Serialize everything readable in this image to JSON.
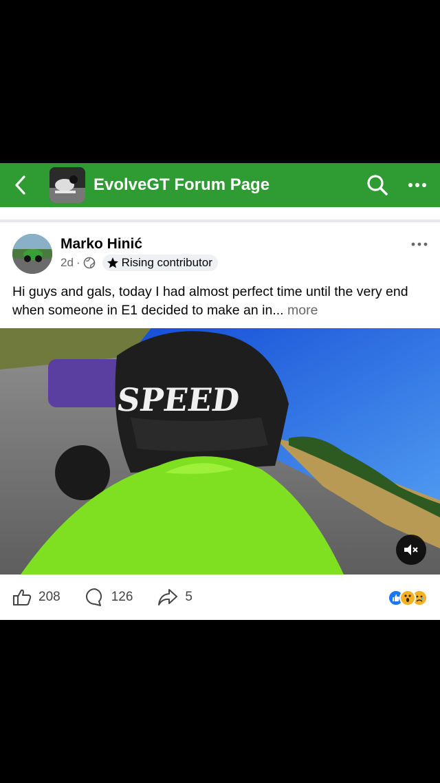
{
  "header": {
    "title": "EvolveGT Forum Page",
    "back_icon": "chevron-left-icon",
    "search_icon": "search-icon",
    "more_icon": "more-horizontal-icon",
    "bar_color": "#2f9b33"
  },
  "post": {
    "author": "Marko Hinić",
    "time": "2d",
    "separator": "·",
    "privacy_icon": "globe-icon",
    "badge_label": "Rising contributor",
    "badge_icon": "star-icon",
    "text": "Hi guys and gals, today I had almost perfect time until the very end when someone in E1 decided to make an in...",
    "more_label": "more",
    "media_icon": "mute-icon"
  },
  "actions": {
    "likes": "208",
    "comments": "126",
    "shares": "5",
    "like_icon": "thumbs-up-icon",
    "comment_icon": "comment-icon",
    "share_icon": "share-icon",
    "reactions": [
      "like",
      "wow",
      "sad"
    ]
  }
}
